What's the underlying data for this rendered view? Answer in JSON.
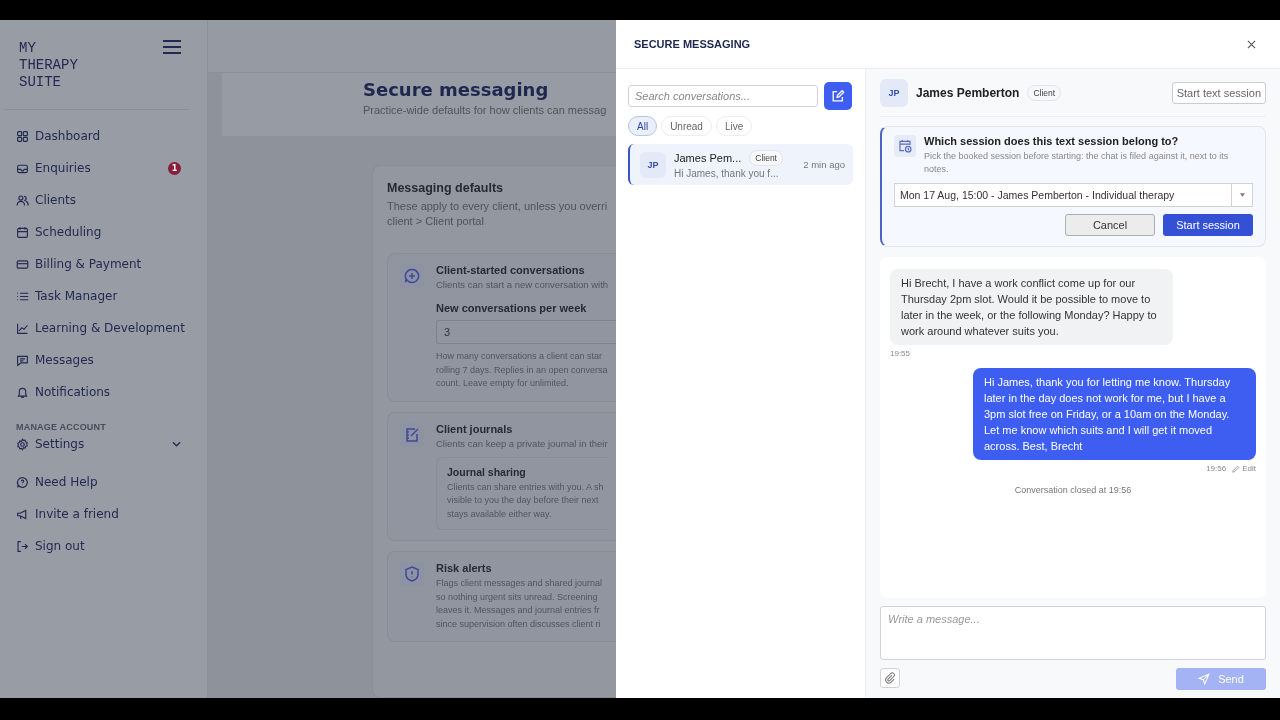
{
  "sidebar": {
    "logo": "MY THERAPY SUITE",
    "nav": [
      {
        "label": "Dashboard"
      },
      {
        "label": "Enquiries",
        "badge": "1"
      },
      {
        "label": "Clients"
      },
      {
        "label": "Scheduling"
      },
      {
        "label": "Billing & Payment"
      },
      {
        "label": "Task Manager"
      },
      {
        "label": "Learning & Development"
      },
      {
        "label": "Messages"
      },
      {
        "label": "Notifications"
      }
    ],
    "section_label": "MANAGE ACCOUNT",
    "settings": {
      "label": "Settings",
      "expanded": false
    },
    "account_links": [
      {
        "label": "Need Help"
      },
      {
        "label": "Invite a friend"
      },
      {
        "label": "Sign out"
      }
    ]
  },
  "page": {
    "title": "Secure messaging",
    "subtitle": "Practice-wide defaults for how clients can messag",
    "card": {
      "title": "Messaging defaults",
      "description_lines": [
        "These apply to every client, unless you overri",
        "client > Client portal"
      ],
      "sections": [
        {
          "kind": "field",
          "title": "Client-started conversations",
          "description": "Clients can start a new conversation with",
          "field_label": "New conversations per week",
          "field_value": "3",
          "help_lines": [
            "How many conversations a client can star",
            "rolling 7 days. Replies in an open conversa",
            "count. Leave empty for unlimited."
          ]
        },
        {
          "kind": "subcard",
          "title": "Client journals",
          "description": "Clients can keep a private journal in their",
          "sub_title": "Journal sharing",
          "sub_lines": [
            "Clients can share entries with you. A sh",
            "visible to you the day before their next",
            "stays available either way."
          ]
        },
        {
          "kind": "text",
          "title": "Risk alerts",
          "lines": [
            "Flags client messages and shared journal",
            "so nothing urgent sits unread. Screening",
            "leaves it. Messages and journal entries fr",
            "since supervision often discusses client ri"
          ]
        }
      ]
    }
  },
  "panel": {
    "title": "SECURE MESSAGING",
    "search": {
      "placeholder": "Search conversations..."
    },
    "filters": [
      {
        "label": "All",
        "selected": true
      },
      {
        "label": "Unread",
        "selected": false
      },
      {
        "label": "Live",
        "selected": false
      }
    ],
    "conversations": [
      {
        "initials": "JP",
        "name": "James Pem...",
        "tag": "Client",
        "preview": "Hi James, thank you f...",
        "time": "2 min ago",
        "selected": true
      }
    ],
    "contact": {
      "initials": "JP",
      "name": "James Pemberton",
      "tag": "Client",
      "action": "Start text session"
    },
    "session_prompt": {
      "title": "Which session does this text session belong to?",
      "description": "Pick the booked session before starting: the chat is filed against it, next to its notes.",
      "selected_session": "Mon 17 Aug, 15:00 - James Pemberton - Individual therapy",
      "cancel": "Cancel",
      "confirm": "Start session"
    },
    "messages": [
      {
        "kind": "incoming",
        "text": "Hi Brecht, I have a work conflict come up for our Thursday 2pm slot. Would it be possible to move to later in the week, or the following Monday? Happy to work around whatever suits you.",
        "time": "19:55"
      },
      {
        "kind": "outgoing",
        "text": "Hi James, thank you for letting me know. Thursday later in the day does not work for me, but I have a 3pm slot free on Friday, or a 10am on the Monday. Let me know which suits and I will get it moved across. Best, Brecht",
        "time": "19:56",
        "edit": "Edit"
      }
    ],
    "system_note": "Conversation closed at 19:56",
    "composer": {
      "placeholder": "Write a message...",
      "send": "Send",
      "send_disabled": true
    }
  }
}
